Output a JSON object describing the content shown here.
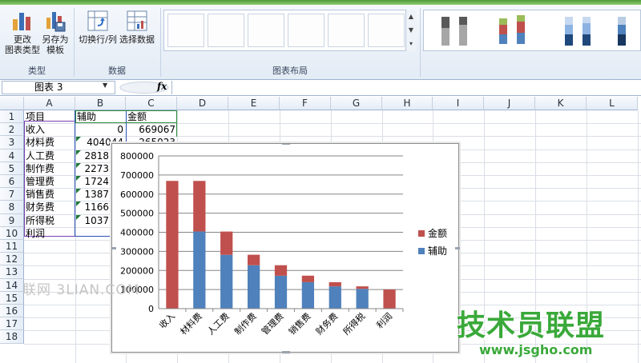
{
  "ribbon": {
    "buttons": [
      {
        "line1": "更改",
        "line2": "图表类型"
      },
      {
        "line1": "另存为",
        "line2": "模板"
      },
      {
        "line1": "切换行/列",
        "line2": ""
      },
      {
        "line1": "选择数据",
        "line2": ""
      }
    ],
    "groups": {
      "type": "类型",
      "data": "数据",
      "layout": "图表布局"
    },
    "gallery_scroll": [
      "▲",
      "▼",
      "▾"
    ]
  },
  "formula_bar": {
    "name_box": "图表 3",
    "fx": "fx",
    "content": ""
  },
  "sheet": {
    "columns": [
      "A",
      "B",
      "C",
      "D",
      "E",
      "F",
      "G",
      "H",
      "I",
      "J",
      "K",
      "L"
    ],
    "rows": [
      "1",
      "2",
      "3",
      "4",
      "5",
      "6",
      "7",
      "8",
      "9",
      "10",
      "11",
      "12",
      "13",
      "14",
      "15",
      "16",
      "17",
      "18"
    ],
    "cells_a": [
      "项目",
      "收入",
      "材料费",
      "人工费",
      "制作费",
      "管理费",
      "销售费",
      "财务费",
      "所得税",
      "利润"
    ],
    "cells_b": [
      "辅助",
      "0",
      "404044",
      "2818",
      "2273",
      "1724",
      "1387",
      "1166",
      "1037",
      ""
    ],
    "cells_c": [
      "金额",
      "669067",
      "265023",
      "",
      "",
      "",
      "",
      "",
      "",
      ""
    ]
  },
  "chart_data": {
    "type": "bar",
    "stacked": true,
    "categories": [
      "收入",
      "材料费",
      "人工费",
      "制作费",
      "管理费",
      "销售费",
      "财务费",
      "所得税",
      "利润"
    ],
    "series": [
      {
        "name": "辅助",
        "color": "#4f81bd",
        "values": [
          0,
          404044,
          281800,
          227300,
          172400,
          138700,
          116600,
          103700,
          0
        ]
      },
      {
        "name": "金额",
        "color": "#c0504d",
        "values": [
          669067,
          265023,
          122000,
          55000,
          55000,
          34000,
          22000,
          13000,
          100000
        ]
      }
    ],
    "ylim": [
      0,
      800000
    ],
    "yticks": [
      "0",
      "100000",
      "200000",
      "300000",
      "400000",
      "500000",
      "600000",
      "700000",
      "800000"
    ],
    "legend": "right",
    "grid": true
  },
  "watermarks": {
    "left": "联网 3LIAN.COM",
    "brand": "技术员联盟",
    "url": "www.jsgho.com"
  }
}
